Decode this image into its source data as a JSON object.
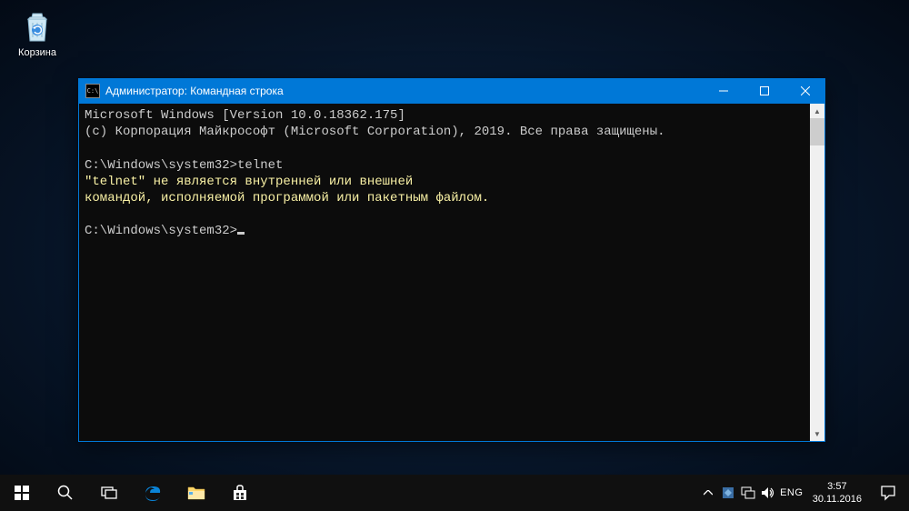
{
  "desktop": {
    "recycle_bin_label": "Корзина"
  },
  "cmd": {
    "title": "Администратор: Командная строка",
    "lines": {
      "version": "Microsoft Windows [Version 10.0.18362.175]",
      "copyright": "(c) Корпорация Майкрософт (Microsoft Corporation), 2019. Все права защищены.",
      "prompt1": "C:\\Windows\\system32>",
      "command1": "telnet",
      "error_l1": "\"telnet\" не является внутренней или внешней",
      "error_l2": "командой, исполняемой программой или пакетным файлом.",
      "prompt2": "C:\\Windows\\system32>"
    }
  },
  "taskbar": {
    "lang": "ENG",
    "time": "3:57",
    "date": "30.11.2016"
  }
}
